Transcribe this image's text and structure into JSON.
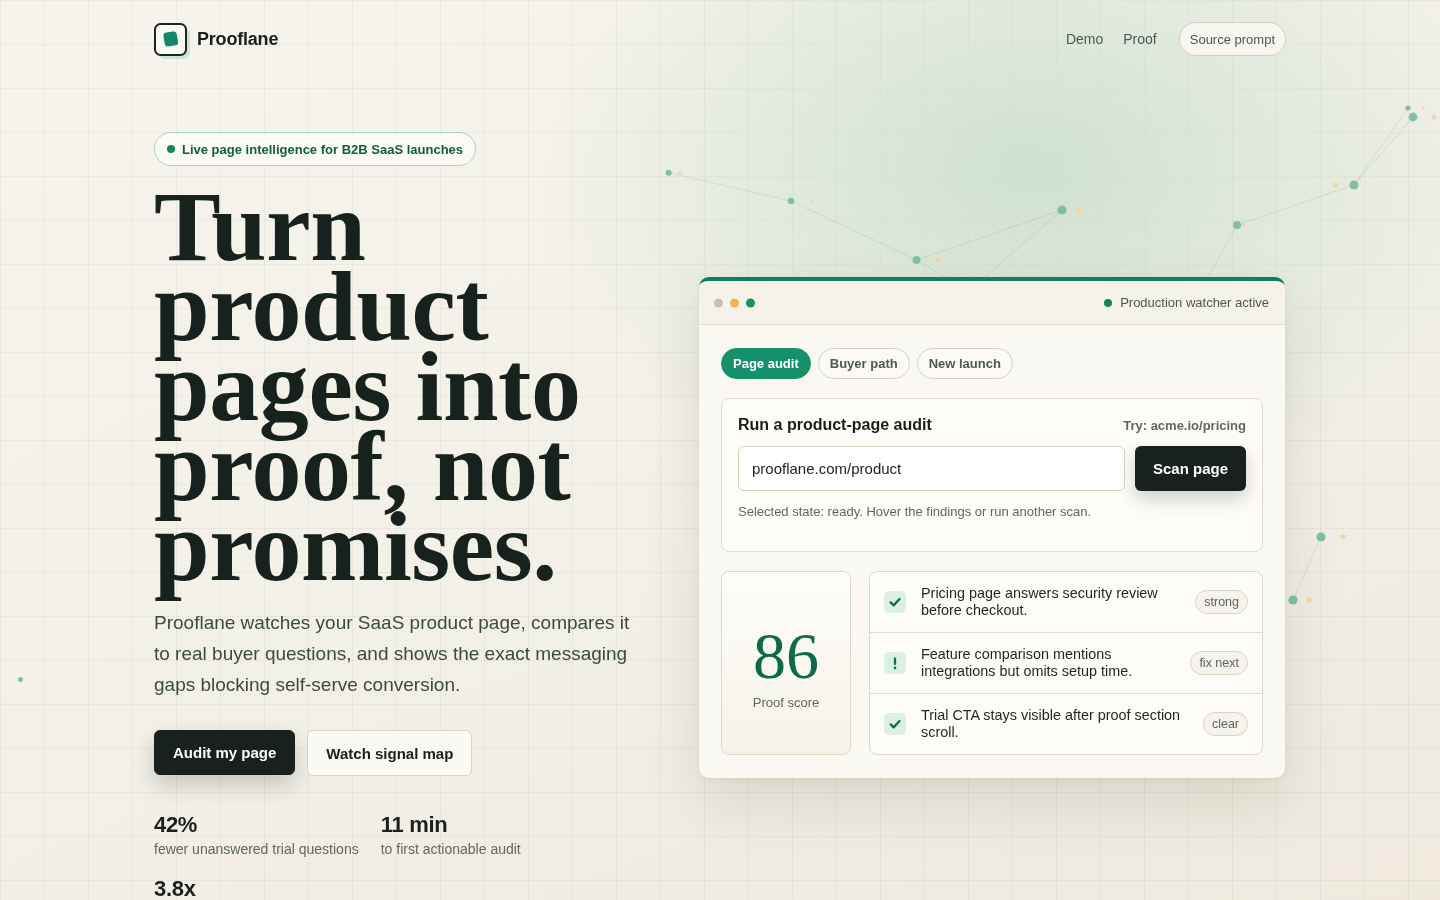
{
  "header": {
    "brand": "Prooflane",
    "nav": [
      "Demo",
      "Proof"
    ],
    "cta": "Source prompt"
  },
  "hero": {
    "badge": "Live page intelligence for B2B SaaS launches",
    "title": "Turn product pages into proof, not promises.",
    "lead": "Prooflane watches your SaaS product page, compares it to real buyer questions, and shows the exact messaging gaps blocking self-serve conversion.",
    "buttons": [
      {
        "label": "Audit my page",
        "kind": "primary"
      },
      {
        "label": "Watch signal map",
        "kind": "secondary"
      }
    ],
    "stats": [
      {
        "value": "42%",
        "label": "fewer unanswered trial questions"
      },
      {
        "value": "11 min",
        "label": "to first actionable audit"
      },
      {
        "value": "3.8x"
      }
    ]
  },
  "audit_card": {
    "status": "Production watcher active",
    "tabs": [
      {
        "label": "Page audit",
        "selected": true
      },
      {
        "label": "Buyer path",
        "selected": false
      },
      {
        "label": "New launch",
        "selected": false
      }
    ],
    "form": {
      "title": "Run a product-page audit",
      "example": "Try: acme.io/pricing",
      "url_field": {
        "value": "prooflane.com/product"
      },
      "button": "Scan page",
      "note": "Selected state: ready. Hover the findings or run another scan."
    },
    "score": {
      "value": "86",
      "label": "Proof score"
    },
    "findings": [
      {
        "kind": "pass",
        "text": "Pricing page answers security review before checkout.",
        "tag": "strong"
      },
      {
        "kind": "warning",
        "text": "Feature comparison mentions integrations but omits setup time.",
        "tag": "fix next"
      },
      {
        "kind": "pass",
        "text": "Trial CTA stays visible after proof section scroll.",
        "tag": "clear"
      }
    ]
  }
}
